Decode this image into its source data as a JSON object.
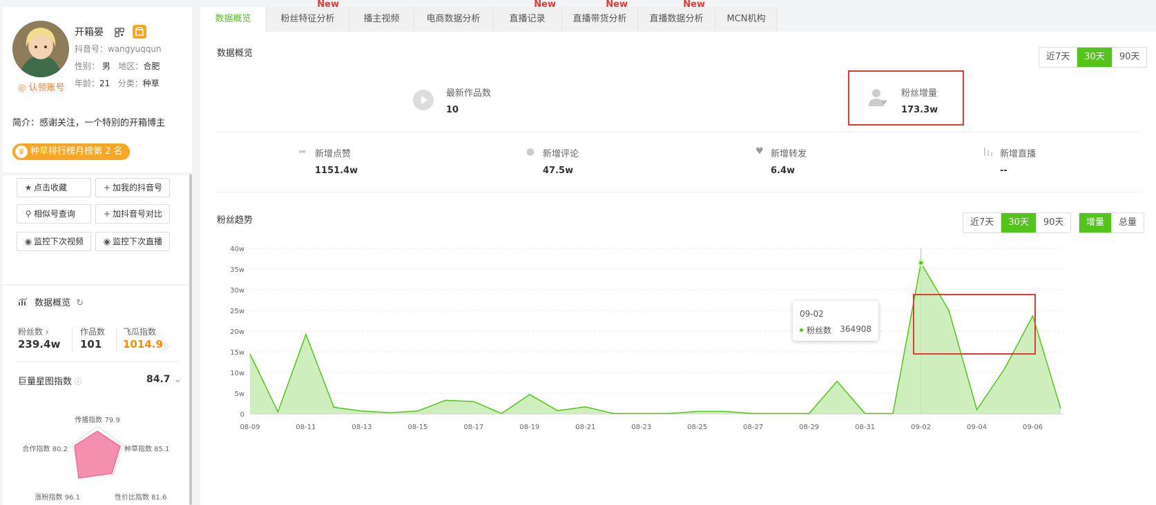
{
  "profile": {
    "name": "开箱晏",
    "douyin_id_label": "抖音号：",
    "douyin_id": "wangyuqqun",
    "gender_label": "性别：",
    "gender": "男",
    "region_label": "地区：",
    "region": "合肥",
    "age_label": "年龄：",
    "age": "21",
    "category_label": "分类：",
    "category": "种草",
    "claim_label": "认领账号",
    "intro": "简介：感谢关注，一个特别的开箱博主",
    "rank_badge": "种草排行榜月榜第 2 名"
  },
  "actions": {
    "favorite": "点击收藏",
    "add_mine": "加我的抖音号",
    "similar": "相似号查询",
    "add_compare": "加抖音号对比",
    "monitor_video": "监控下次视频",
    "monitor_live": "监控下次直播"
  },
  "side_overview": {
    "title": "数据概览",
    "fans_label": "粉丝数",
    "fans_value": "239.4w",
    "works_label": "作品数",
    "works_value": "101",
    "feigua_label": "飞瓜指数",
    "feigua_value": "1014.9",
    "juliang_label": "巨量星图指数",
    "juliang_value": "84.7"
  },
  "radar": {
    "spread": "传播指数 79.9",
    "grass": "种草指数 85.1",
    "value": "性价比指数 81.6",
    "growth": "涨粉指数 96.1",
    "coop": "合作指数 80.2"
  },
  "tabs": [
    {
      "label": "数据概览",
      "new": ""
    },
    {
      "label": "粉丝特征分析",
      "new": "New"
    },
    {
      "label": "播主视频",
      "new": ""
    },
    {
      "label": "电商数据分析",
      "new": ""
    },
    {
      "label": "直播记录",
      "new": "New"
    },
    {
      "label": "直播带货分析",
      "new": "New"
    },
    {
      "label": "直播数据分析",
      "new": "New"
    },
    {
      "label": "MCN机构",
      "new": ""
    }
  ],
  "overview": {
    "title": "数据概览",
    "range": [
      "近7天",
      "30天",
      "90天"
    ],
    "latest_works_label": "最新作品数",
    "latest_works_value": "10",
    "fans_inc_label": "粉丝增量",
    "fans_inc_value": "173.3w",
    "likes_label": "新增点赞",
    "likes_value": "1151.4w",
    "comments_label": "新增评论",
    "comments_value": "47.5w",
    "shares_label": "新增转发",
    "shares_value": "6.4w",
    "lives_label": "新增直播",
    "lives_value": "--"
  },
  "trend": {
    "title": "粉丝趋势",
    "range": [
      "近7天",
      "30天",
      "90天"
    ],
    "mode": [
      "增量",
      "总量"
    ],
    "tooltip_date": "09-02",
    "tooltip_series": "粉丝数",
    "tooltip_value": "364908"
  },
  "chart_data": {
    "type": "area",
    "x": [
      "08-09",
      "08-10",
      "08-11",
      "08-12",
      "08-13",
      "08-14",
      "08-15",
      "08-16",
      "08-17",
      "08-18",
      "08-19",
      "08-20",
      "08-21",
      "08-22",
      "08-23",
      "08-24",
      "08-25",
      "08-26",
      "08-27",
      "08-28",
      "08-29",
      "08-30",
      "08-31",
      "09-01",
      "09-02",
      "09-03",
      "09-04",
      "09-05",
      "09-06",
      "09-07"
    ],
    "x_tick_labels": [
      "08-09",
      "08-11",
      "08-13",
      "08-15",
      "08-17",
      "08-19",
      "08-21",
      "08-23",
      "08-25",
      "08-27",
      "08-29",
      "08-31",
      "09-02",
      "09-04",
      "09-06"
    ],
    "y_tick_labels": [
      "0",
      "5w",
      "10w",
      "15w",
      "20w",
      "25w",
      "30w",
      "35w",
      "40w"
    ],
    "ylim": [
      0,
      400000
    ],
    "series": [
      {
        "name": "粉丝数",
        "values": [
          145000,
          5000,
          192000,
          16000,
          7000,
          3000,
          7000,
          33000,
          30000,
          1000,
          47000,
          8000,
          17000,
          1000,
          1000,
          1000,
          6000,
          6000,
          1000,
          1000,
          1000,
          79000,
          1000,
          1000,
          364908,
          250000,
          10000,
          110000,
          237000,
          13000
        ]
      }
    ],
    "color": "#52c41a",
    "fill": "#c7ebb1",
    "grid": true
  }
}
